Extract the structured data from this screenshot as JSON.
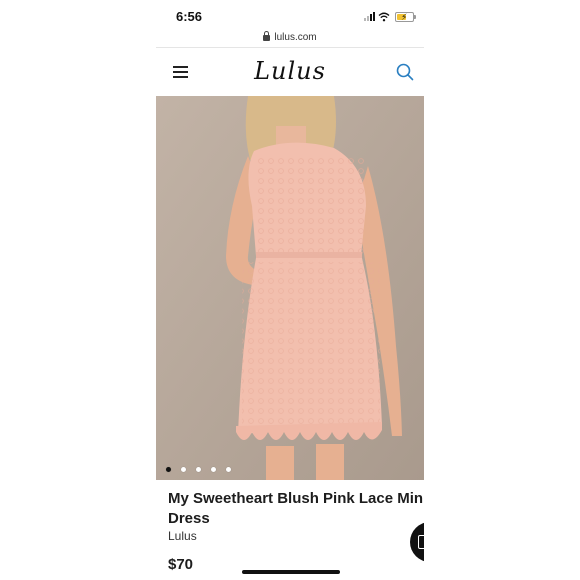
{
  "status_bar": {
    "time": "6:56"
  },
  "browser": {
    "url": "lulus.com"
  },
  "header": {
    "logo_text": "Lulus",
    "menu_icon": "hamburger-menu-icon",
    "search_icon": "search-icon",
    "accent_color": "#2a7fc1"
  },
  "carousel": {
    "slide_count": 5,
    "active_index": 0
  },
  "product": {
    "title_line1": "My Sweetheart Blush Pink Lace Min",
    "title_line2": "Dress",
    "brand": "Lulus",
    "price": "$70"
  },
  "colors": {
    "dress": "#f2bfae",
    "background": "#b7a89b"
  }
}
